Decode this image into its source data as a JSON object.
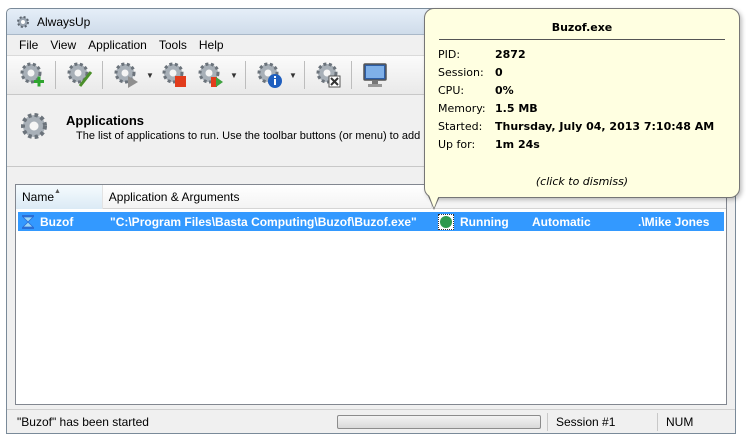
{
  "window": {
    "title": "AlwaysUp"
  },
  "menu": {
    "items": [
      "File",
      "View",
      "Application",
      "Tools",
      "Help"
    ]
  },
  "toolbar": {
    "buttons": [
      "add-application-icon",
      "edit-application-icon",
      "start-application-icon",
      "stop-application-icon",
      "restart-application-icon",
      "report-activity-icon",
      "remove-application-icon",
      "display-icon"
    ]
  },
  "header": {
    "title": "Applications",
    "description": "The list of applications to run. Use the toolbar buttons (or menu) to add n"
  },
  "list": {
    "columns": [
      "Name",
      "Application & Arguments"
    ],
    "rows": [
      {
        "name": "Buzof",
        "application": "\"C:\\Program Files\\Basta Computing\\Buzof\\Buzof.exe\"",
        "status": "Running",
        "startup": "Automatic",
        "account": ".\\Mike Jones"
      }
    ]
  },
  "tooltip": {
    "title": "Buzof.exe",
    "fields": [
      {
        "label": "PID:",
        "value": "2872"
      },
      {
        "label": "Session:",
        "value": "0"
      },
      {
        "label": "CPU:",
        "value": "0%"
      },
      {
        "label": "Memory:",
        "value": "1.5 MB"
      },
      {
        "label": "Started:",
        "value": "Thursday, July 04, 2013 7:10:48 AM"
      },
      {
        "label": "Up for:",
        "value": "1m 24s"
      }
    ],
    "dismiss": "(click to dismiss)"
  },
  "status": {
    "message": "\"Buzof\" has been started",
    "progress": 0.0,
    "session": "Session #1",
    "num": "NUM"
  },
  "colors": {
    "selection": "#3399ff",
    "tooltip_bg": "#ffffe1",
    "running": "#2e9a4e"
  }
}
